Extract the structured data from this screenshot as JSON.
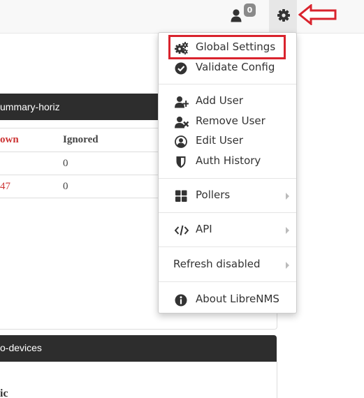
{
  "navbar": {
    "notifications_count": "0"
  },
  "panels": {
    "top_title": "ummary-horiz",
    "table_headers": [
      "own",
      "Ignored"
    ],
    "rows": [
      {
        "down": "",
        "ignored": "0"
      },
      {
        "down": "47",
        "ignored": "0"
      }
    ],
    "bottom_title": "o-devices",
    "bottom_text": "ic"
  },
  "menu": {
    "items": [
      {
        "label": "Global Settings",
        "icon": "cogs-icon"
      },
      {
        "label": "Validate Config",
        "icon": "check-circle-icon"
      },
      {
        "label": "Add User",
        "icon": "user-plus-icon"
      },
      {
        "label": "Remove User",
        "icon": "user-times-icon"
      },
      {
        "label": "Edit User",
        "icon": "user-circle-icon"
      },
      {
        "label": "Auth History",
        "icon": "shield-icon"
      },
      {
        "label": "Pollers",
        "icon": "th-large-icon"
      },
      {
        "label": "API",
        "icon": "code-icon"
      },
      {
        "label": "Refresh disabled",
        "icon": ""
      },
      {
        "label": "About LibreNMS",
        "icon": "info-circle-icon"
      }
    ]
  },
  "colors": {
    "highlight": "#d9232d",
    "panel_header": "#2d2d2d",
    "link_red": "#cc3333"
  }
}
